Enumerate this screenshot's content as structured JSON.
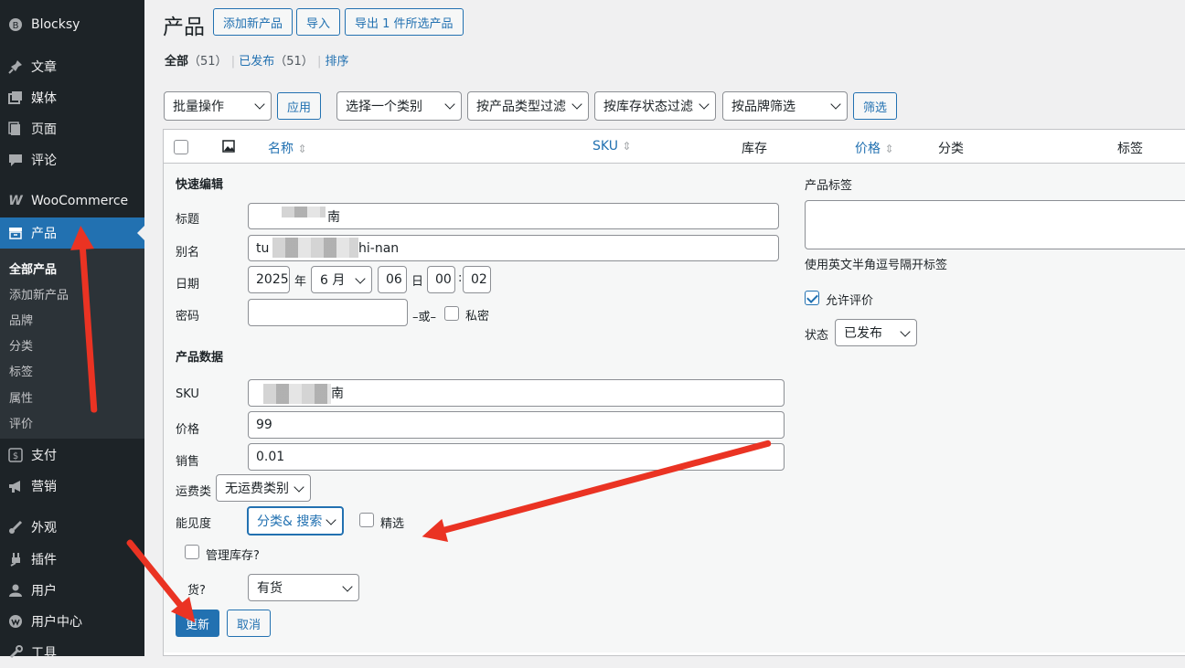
{
  "sidebar": {
    "brand": "Blocksy",
    "menu": {
      "posts": "文章",
      "media": "媒体",
      "pages": "页面",
      "comments": "评论",
      "woocommerce": "WooCommerce",
      "products": "产品",
      "payments": "支付",
      "marketing": "营销",
      "appearance": "外观",
      "plugins": "插件",
      "users": "用户",
      "user_center": "用户中心",
      "tools": "工具"
    },
    "submenu": {
      "all_products": "全部产品",
      "add_new": "添加新产品",
      "brands": "品牌",
      "categories": "分类",
      "tags": "标签",
      "attributes": "属性",
      "reviews": "评价"
    }
  },
  "header": {
    "title": "产品",
    "add_new": "添加新产品",
    "import": "导入",
    "export": "导出 1 件所选产品"
  },
  "views": {
    "all": "全部",
    "all_count": "（51）",
    "published": "已发布",
    "published_count": "（51）",
    "sort": "排序",
    "sep": "|"
  },
  "filters": {
    "bulk_action": "批量操作",
    "apply": "应用",
    "category": "选择一个类别",
    "product_type": "按产品类型过滤",
    "stock_status": "按库存状态过滤",
    "brand": "按品牌筛选",
    "filter_button": "筛选"
  },
  "table": {
    "columns": {
      "name": "名称",
      "sku": "SKU",
      "stock": "库存",
      "price": "价格",
      "categories": "分类",
      "tags": "标签"
    },
    "sort_icon": "⇕"
  },
  "quick_edit": {
    "heading": "快速编辑",
    "title_label": "标题",
    "title_value": "南",
    "slug_label": "别名",
    "slug_value_start": "tu",
    "slug_value_end": "hi-nan",
    "date_label": "日期",
    "year": "2025",
    "year_sep": "年",
    "month": "6 月",
    "day": "06",
    "day_sep": "日",
    "hour": "00",
    "time_sep": ":",
    "minute": "02",
    "password_label": "密码",
    "password_value": "",
    "or_label": "–或–",
    "private_label": "私密",
    "product_data_heading": "产品数据",
    "sku_label": "SKU",
    "sku_value": "南",
    "price_label": "价格",
    "price_value": "99",
    "sale_label": "销售",
    "sale_value": "0.01",
    "shipping_label": "运费类",
    "shipping_value": "无运费类别",
    "visibility_label": "能见度",
    "visibility_value": "分类& 搜索",
    "featured_label": "精选",
    "manage_stock_label": "管理库存?",
    "in_stock_label": "货?",
    "in_stock_value": "有货",
    "update": "更新",
    "cancel": "取消",
    "tags_heading": "产品标签",
    "tags_value": "",
    "tags_hint": "使用英文半角逗号隔开标签",
    "allow_comments_label": "允许评价",
    "allow_comments_checked": true,
    "status_label": "状态",
    "status_value": "已发布"
  },
  "annotations": {
    "color": "#ea3323"
  }
}
